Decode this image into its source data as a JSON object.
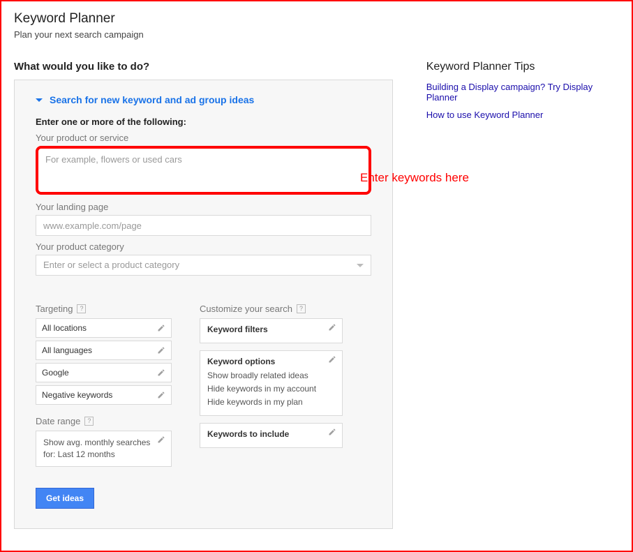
{
  "page": {
    "title": "Keyword Planner",
    "subtitle": "Plan your next search campaign",
    "question": "What would you like to do?"
  },
  "expand": {
    "title": "Search for new keyword and ad group ideas"
  },
  "fields": {
    "enter_label": "Enter one or more of the following:",
    "product_service_label": "Your product or service",
    "product_service_placeholder": "For example, flowers or used cars",
    "landing_label": "Your landing page",
    "landing_placeholder": "www.example.com/page",
    "category_label": "Your product category",
    "category_placeholder": "Enter or select a product category"
  },
  "targeting": {
    "label": "Targeting",
    "locations": "All locations",
    "languages": "All languages",
    "networks": "Google",
    "negative": "Negative keywords"
  },
  "daterange": {
    "label": "Date range",
    "text": "Show avg. monthly searches for: Last 12 months"
  },
  "customize": {
    "label": "Customize your search",
    "filters_title": "Keyword filters",
    "options_title": "Keyword options",
    "options_lines": {
      "a": "Show broadly related ideas",
      "b": "Hide keywords in my account",
      "c": "Hide keywords in my plan"
    },
    "include_title": "Keywords to include"
  },
  "button": {
    "get_ideas": "Get ideas"
  },
  "tips": {
    "heading": "Keyword Planner Tips",
    "link1": "Building a Display campaign? Try Display Planner",
    "link2": "How to use Keyword Planner"
  },
  "annotation": {
    "text": "Enter keywords here"
  }
}
